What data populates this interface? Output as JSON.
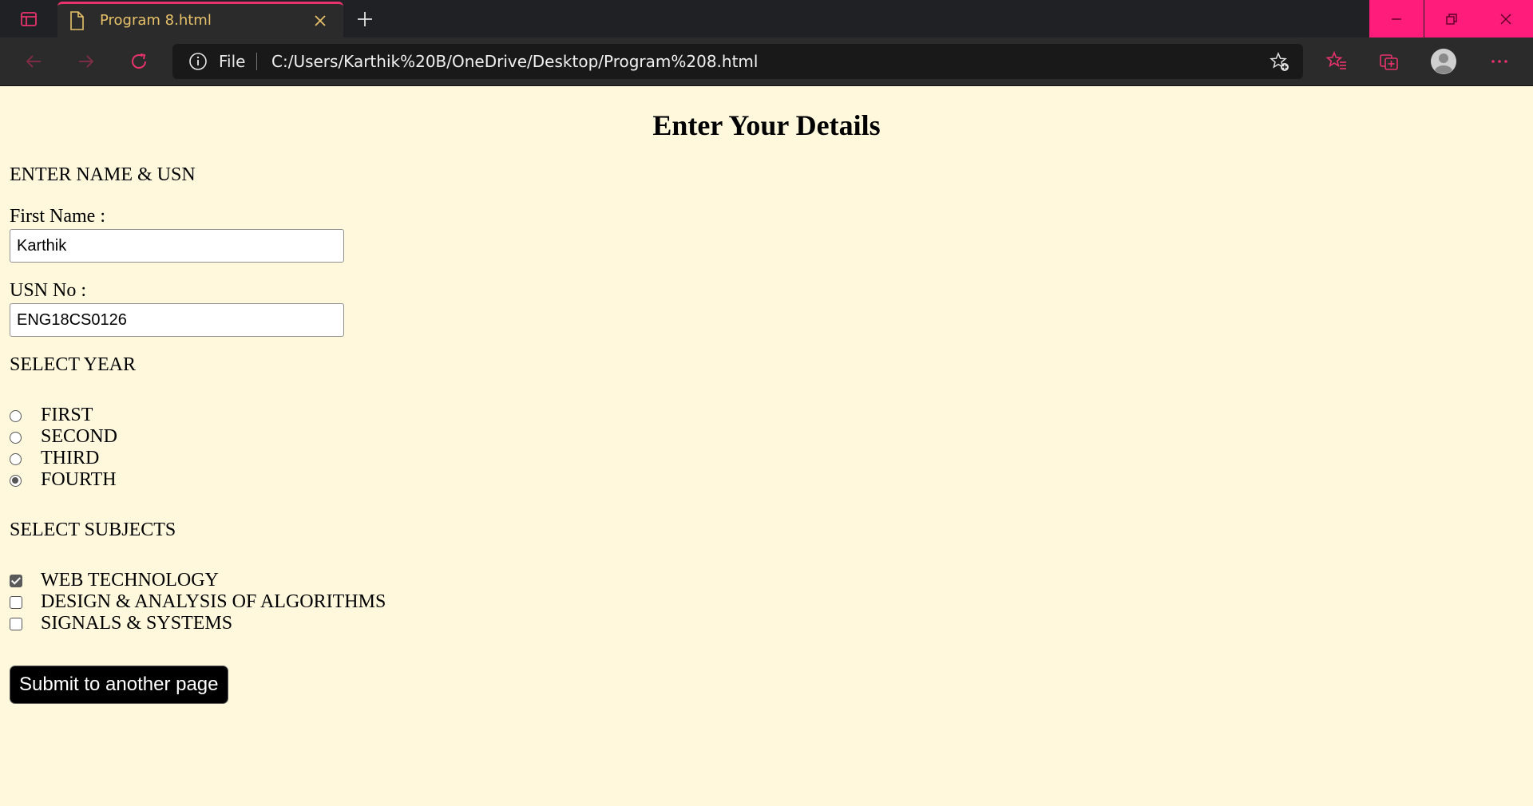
{
  "browser": {
    "tab": {
      "title": "Program 8.html"
    },
    "address": {
      "site_label": "File",
      "url": "C:/Users/Karthik%20B/OneDrive/Desktop/Program%208.html"
    },
    "colors": {
      "accent": "#ff1c7a",
      "tab_title": "#e8c26a",
      "toolbar": "#2b2b2b",
      "tabbar": "#202124"
    }
  },
  "page": {
    "background": "#fff8dc",
    "heading": "Enter Your Details",
    "name_section": {
      "title": "ENTER NAME & USN",
      "first_name_label": "First Name :",
      "first_name_value": "Karthik",
      "usn_label": "USN No :",
      "usn_value": "ENG18CS0126"
    },
    "year_section": {
      "title": "SELECT YEAR",
      "options": [
        {
          "label": "FIRST",
          "checked": false
        },
        {
          "label": "SECOND",
          "checked": false
        },
        {
          "label": "THIRD",
          "checked": false
        },
        {
          "label": "FOURTH",
          "checked": true
        }
      ]
    },
    "subject_section": {
      "title": "SELECT SUBJECTS",
      "options": [
        {
          "label": "WEB TECHNOLOGY",
          "checked": true
        },
        {
          "label": "DESIGN & ANALYSIS OF ALGORITHMS",
          "checked": false
        },
        {
          "label": "SIGNALS & SYSTEMS",
          "checked": false
        }
      ]
    },
    "submit_label": "Submit to another page"
  }
}
